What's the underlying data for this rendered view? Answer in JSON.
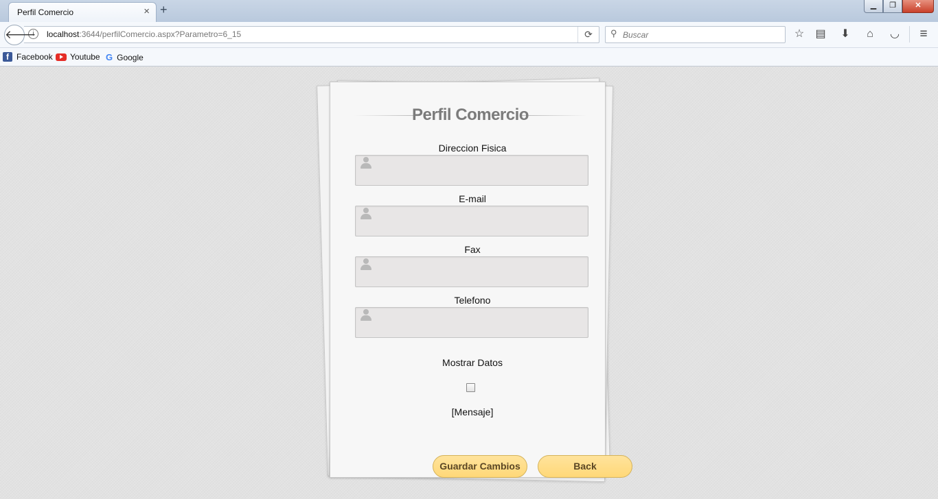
{
  "browser": {
    "tab_title": "Perfil Comercio",
    "tab_close": "×",
    "new_tab": "+",
    "url_host": "localhost",
    "url_rest": ":3644/perfilComercio.aspx?Parametro=6_15",
    "search_placeholder": "Buscar",
    "toolbar_icons": [
      "bookmark-star-icon",
      "reading-list-icon",
      "download-icon",
      "home-icon",
      "pocket-icon",
      "menu-icon"
    ],
    "window_controls": [
      "minimize",
      "restore",
      "close"
    ]
  },
  "bookmarks": [
    {
      "label": "Facebook",
      "icon": "facebook-icon"
    },
    {
      "label": "Youtube",
      "icon": "youtube-icon"
    },
    {
      "label": "Google",
      "icon": "google-icon"
    }
  ],
  "form": {
    "title": "Perfil Comercio",
    "fields": [
      {
        "label": "Direccion Fisica",
        "value": ""
      },
      {
        "label": "E-mail",
        "value": ""
      },
      {
        "label": "Fax",
        "value": ""
      },
      {
        "label": "Telefono",
        "value": ""
      }
    ],
    "checkbox_label": "Mostrar Datos",
    "checkbox_checked": false,
    "message": "[Mensaje]",
    "save_label": "Guardar Cambios",
    "back_label": "Back"
  },
  "colors": {
    "page_background": "#e2e2e2",
    "button_fill": "#ffdf8c",
    "button_text": "#5a4624",
    "title_text": "#7b7b7b"
  }
}
